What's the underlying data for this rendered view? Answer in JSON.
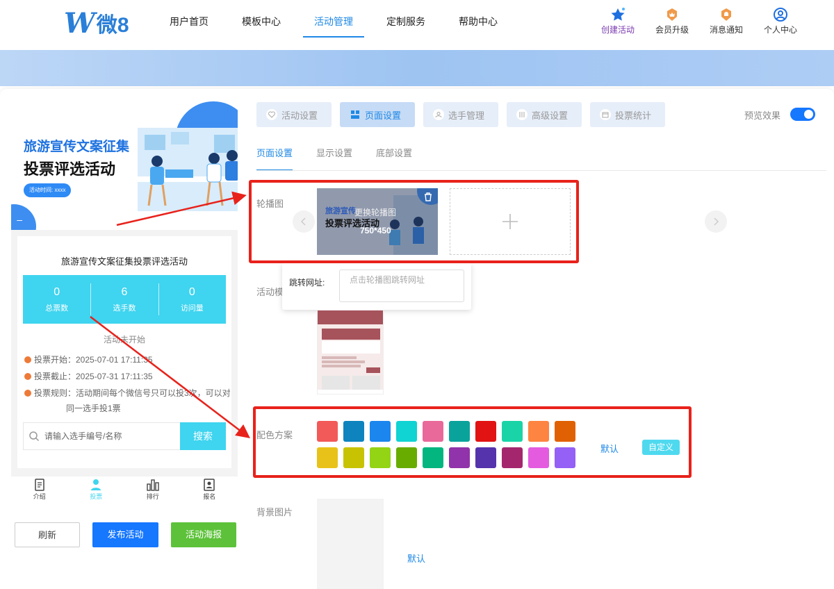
{
  "header": {
    "logo_text": "微8",
    "nav": [
      "用户首页",
      "模板中心",
      "活动管理",
      "定制服务",
      "帮助中心"
    ],
    "active_nav": 2,
    "tools": [
      "创建活动",
      "会员升级",
      "消息通知",
      "个人中心"
    ]
  },
  "preview": {
    "hero_line1": "旅游宣传文案征集",
    "hero_line2": "投票评选活动",
    "hero_tag": "活动时间: xxxx",
    "title": "旅游宣传文案征集投票评选活动",
    "stats": [
      {
        "value": "0",
        "label": "总票数"
      },
      {
        "value": "6",
        "label": "选手数"
      },
      {
        "value": "0",
        "label": "访问量"
      }
    ],
    "status": "活动未开始",
    "vote_start": "投票开始：2025-07-01 17:11:35",
    "vote_end": "投票截止：2025-07-31 17:11:35",
    "vote_rule_1": "投票规则：活动期间每个微信号只可以投3次，可以对",
    "vote_rule_2": "同一选手投1票",
    "search_placeholder": "请输入选手编号/名称",
    "search_button": "搜索",
    "tabbar": [
      "介绍",
      "投票",
      "排行",
      "报名"
    ],
    "active_tab": 1
  },
  "actions": {
    "refresh": "刷新",
    "publish": "发布活动",
    "poster": "活动海报"
  },
  "settings": {
    "tabs": [
      "活动设置",
      "页面设置",
      "选手管理",
      "高级设置",
      "投票统计"
    ],
    "active_tab": 1,
    "preview_toggle_label": "预览效果",
    "preview_toggle_on": true,
    "subtabs": [
      "页面设置",
      "显示设置",
      "底部设置"
    ],
    "active_subtab": 0,
    "carousel_label": "轮播图",
    "carousel_slide_line1": "旅游宣传",
    "carousel_slide_line2": "投票评选活动",
    "carousel_change_text": "更换轮播图",
    "carousel_size": "750*450",
    "jump_label": "跳转网址:",
    "jump_placeholder": "点击轮播图跳转网址",
    "template_label": "活动模",
    "color_label": "配色方案",
    "colors": [
      "#f25a5a",
      "#0e84bf",
      "#1a86ee",
      "#10d3d3",
      "#e8699a",
      "#0aa39b",
      "#e11313",
      "#1ad4a8",
      "#fd8441",
      "#e06104",
      "#e8c219",
      "#c8c302",
      "#93d414",
      "#68ac00",
      "#03b57f",
      "#9133aa",
      "#5433ad",
      "#a4276e",
      "#e45be0",
      "#9460f5"
    ],
    "color_default": "默认",
    "color_custom": "自定义",
    "bg_label": "背景图片",
    "bg_default": "默认"
  }
}
